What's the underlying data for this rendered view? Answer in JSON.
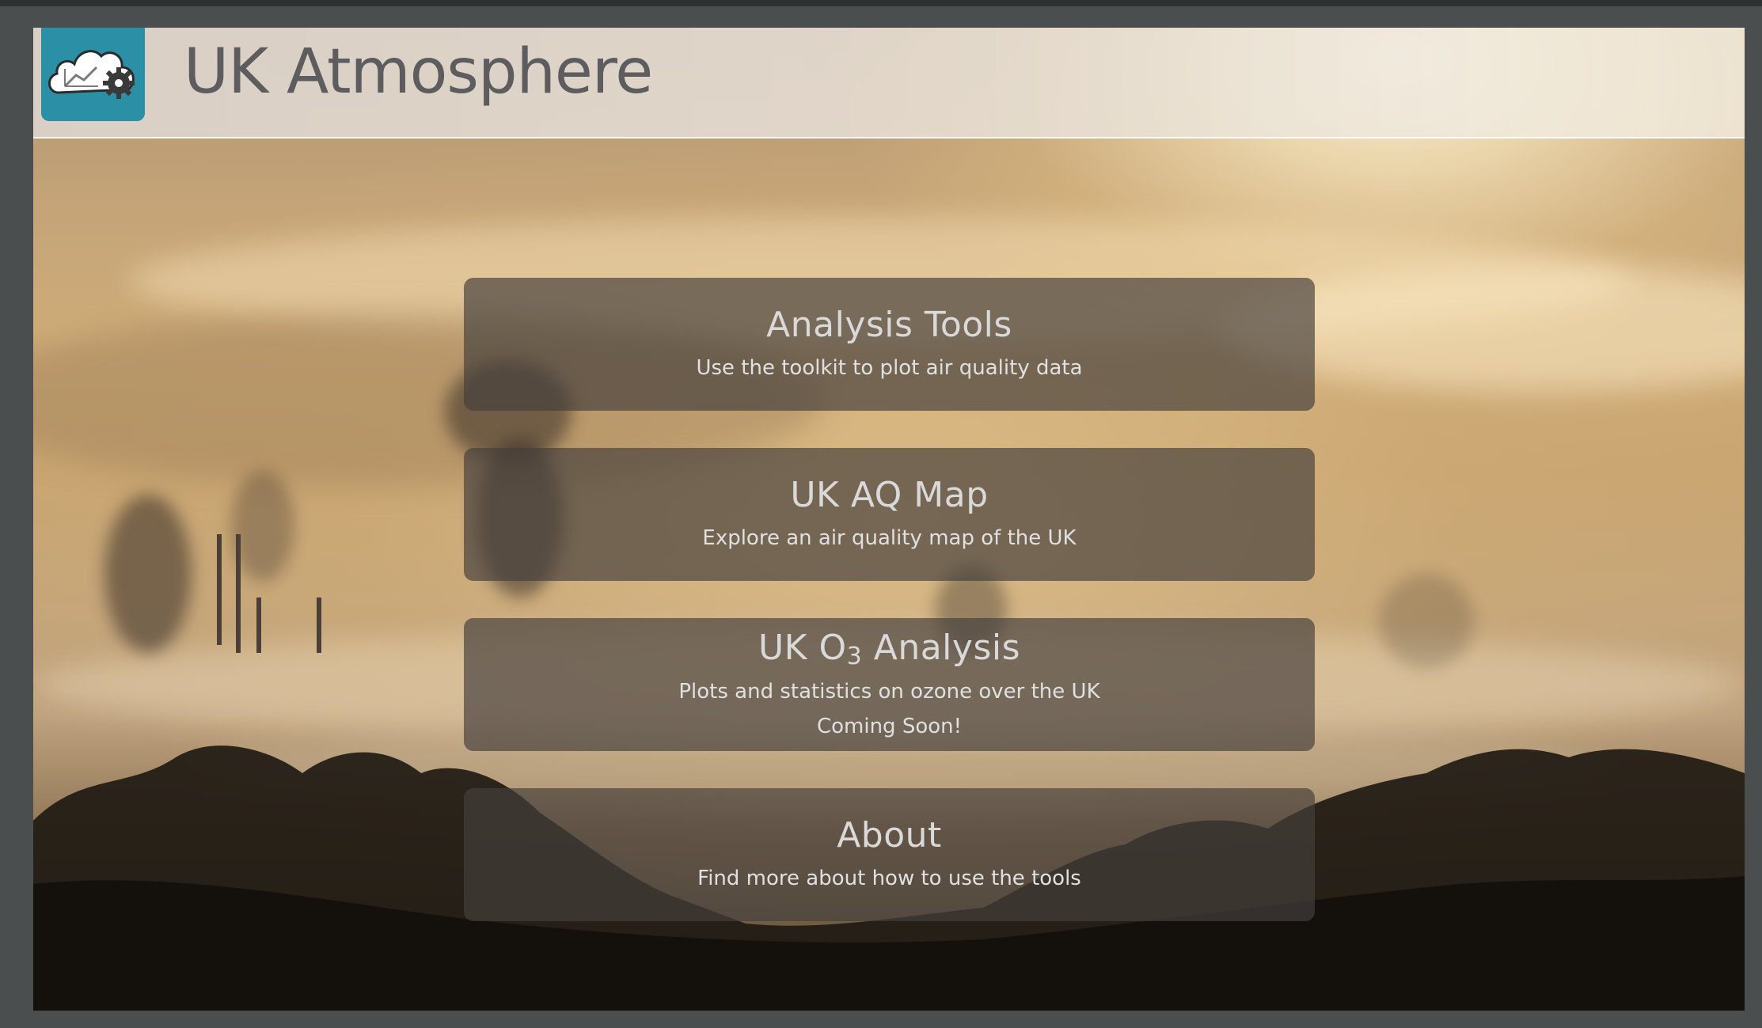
{
  "app": {
    "title": "UK Atmosphere",
    "logo_icon": "cloud-chart-gear-icon",
    "logo_color": "#2b8fa6"
  },
  "menu": [
    {
      "id": "analysis-tools",
      "title": "Analysis Tools",
      "description": "Use the toolkit to plot air quality data"
    },
    {
      "id": "uk-aq-map",
      "title": "UK AQ Map",
      "description": "Explore an air quality map of the UK"
    },
    {
      "id": "uk-o3-analysis",
      "title_prefix": "UK O",
      "title_subscript": "3",
      "title_suffix": " Analysis",
      "description": "Plots and statistics on ozone over the UK",
      "note": "Coming Soon!"
    },
    {
      "id": "about",
      "title": "About",
      "description": "Find more about how to use the tools"
    }
  ],
  "colors": {
    "card_bg": "rgba(70,64,60,0.68)",
    "title_text": "#5d5d5f",
    "card_text": "#d9d9d9"
  }
}
